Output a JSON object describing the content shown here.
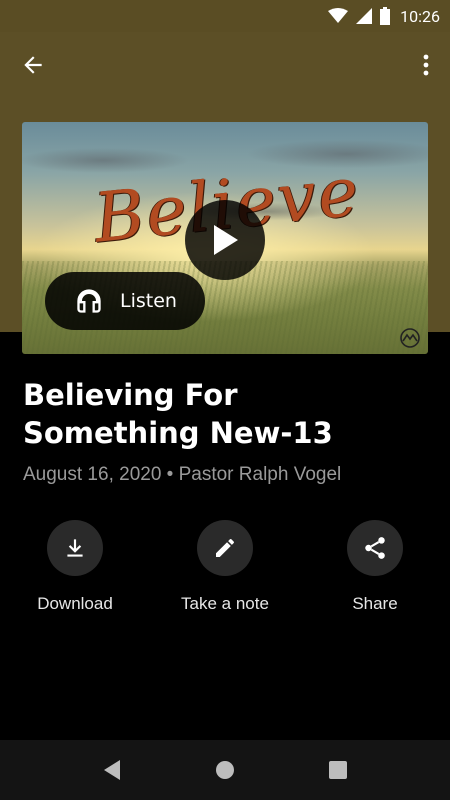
{
  "status_bar": {
    "time": "10:26",
    "icons": [
      "wifi-icon",
      "cell-signal-icon",
      "battery-icon"
    ]
  },
  "app_bar": {
    "back_icon": "arrow-back-icon",
    "more_icon": "more-vert-icon"
  },
  "hero": {
    "art_text": "Believe",
    "play_icon": "play-icon",
    "listen_label": "Listen",
    "listen_icon": "headphones-icon"
  },
  "sermon": {
    "title": "Believing For Something New-13",
    "meta": "August 16, 2020 • Pastor Ralph Vogel"
  },
  "actions": [
    {
      "label": "Download",
      "icon": "download-icon"
    },
    {
      "label": "Take a note",
      "icon": "pencil-icon"
    },
    {
      "label": "Share",
      "icon": "share-icon"
    }
  ],
  "nav": {
    "icons": [
      "nav-back-icon",
      "nav-home-icon",
      "nav-recents-icon"
    ]
  },
  "colors": {
    "header_bg": "#5c4f26",
    "page_bg": "#000000",
    "button_bg": "#2a2a2a",
    "nav_bg": "#141414",
    "meta_text": "#9a9a9a"
  }
}
